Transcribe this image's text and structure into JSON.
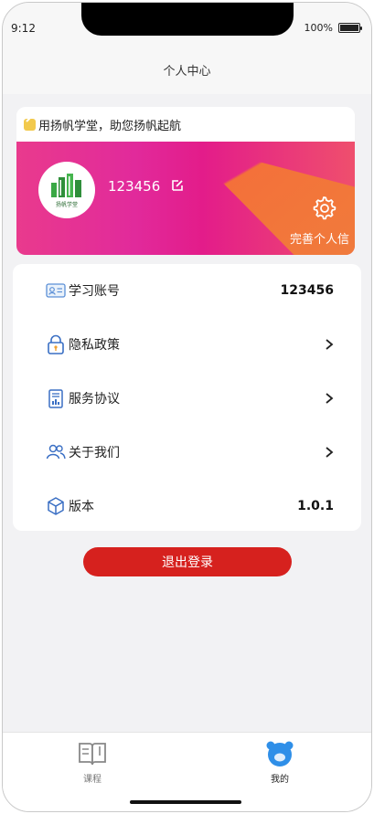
{
  "status_bar": {
    "time": "9:12",
    "battery_text": "100%"
  },
  "header": {
    "title": "个人中心"
  },
  "profile": {
    "notice": "用扬帆学堂，助您扬帆起航",
    "avatar_text": "扬帆学堂",
    "user_id": "123456",
    "settings_label": "完善个人信"
  },
  "menu": {
    "items": [
      {
        "label": "学习账号",
        "value": "123456",
        "icon": "id-card-icon"
      },
      {
        "label": "隐私政策",
        "icon": "lock-icon"
      },
      {
        "label": "服务协议",
        "icon": "document-icon"
      },
      {
        "label": "关于我们",
        "icon": "users-icon"
      },
      {
        "label": "版本",
        "value": "1.0.1",
        "icon": "cube-icon"
      }
    ]
  },
  "logout_label": "退出登录",
  "tabbar": {
    "tabs": [
      {
        "label": "课程",
        "icon": "book-icon",
        "active": false
      },
      {
        "label": "我的",
        "icon": "bear-icon",
        "active": true
      }
    ]
  },
  "colors": {
    "accent": "#d6211e",
    "banner_pink": "#e12a9b",
    "banner_orange": "#f07a3c",
    "tab_active": "#2f8fe8"
  }
}
